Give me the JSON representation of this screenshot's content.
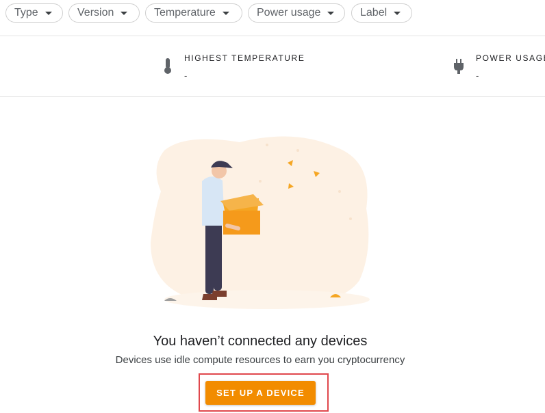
{
  "filters": [
    {
      "label": "Type"
    },
    {
      "label": "Version"
    },
    {
      "label": "Temperature"
    },
    {
      "label": "Power usage"
    },
    {
      "label": "Label"
    }
  ],
  "stats": {
    "highest_temperature": {
      "label": "HIGHEST TEMPERATURE",
      "value": "-",
      "icon": "thermometer-icon"
    },
    "power_usage": {
      "label": "POWER USAGE",
      "value": "-",
      "icon": "power-plug-icon"
    }
  },
  "empty_state": {
    "title": "You haven’t connected any devices",
    "subtitle": "Devices use idle compute resources to earn you cryptocurrency",
    "cta_label": "SET UP A DEVICE",
    "illustration": "person-holding-box-illustration"
  },
  "colors": {
    "accent": "#f28c00",
    "highlight": "#e0474c"
  }
}
